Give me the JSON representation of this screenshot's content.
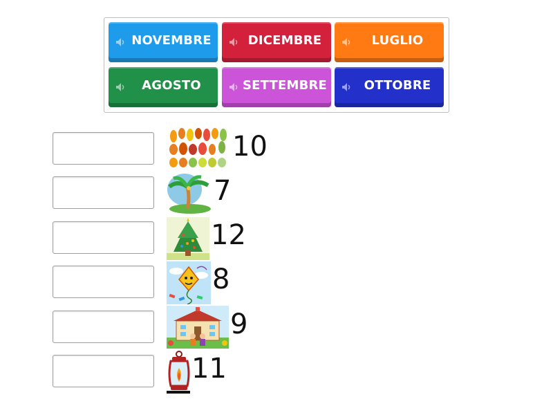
{
  "word_bank": {
    "tiles": [
      {
        "label": "NOVEMBRE",
        "color": "#1e9bea"
      },
      {
        "label": "DICEMBRE",
        "color": "#d3203b"
      },
      {
        "label": "LUGLIO",
        "color": "#ff7a12"
      },
      {
        "label": "AGOSTO",
        "color": "#21914a"
      },
      {
        "label": "SETTEMBRE",
        "color": "#cc54d9"
      },
      {
        "label": "OTTOBRE",
        "color": "#2330c9"
      }
    ],
    "speaker_icon": "speaker-icon"
  },
  "rows": [
    {
      "number": "10",
      "image": "autumn-leaves-icon"
    },
    {
      "number": "7",
      "image": "palm-tree-island-icon"
    },
    {
      "number": "12",
      "image": "christmas-tree-icon"
    },
    {
      "number": "8",
      "image": "kite-icon"
    },
    {
      "number": "9",
      "image": "school-children-icon"
    },
    {
      "number": "11",
      "image": "lantern-icon"
    }
  ]
}
